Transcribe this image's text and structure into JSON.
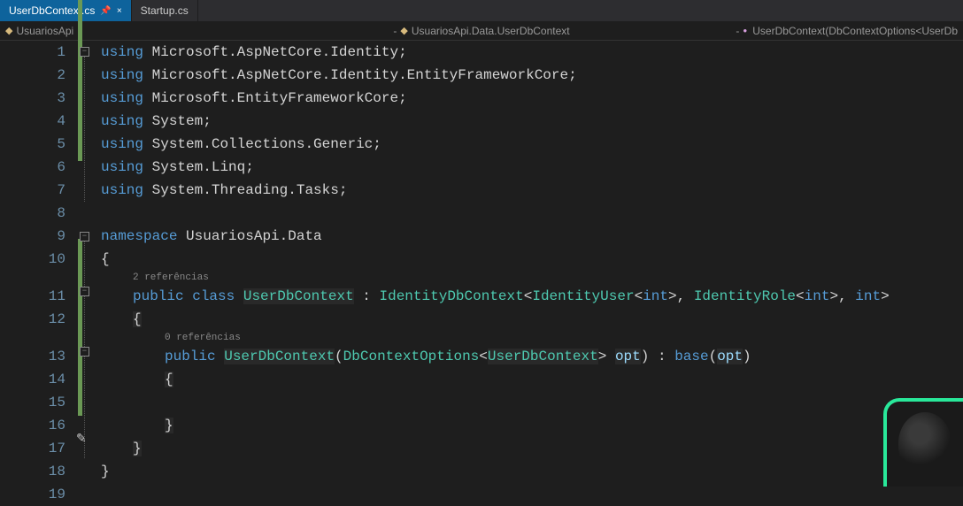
{
  "tabs": {
    "active": "UserDbContext.cs",
    "inactive": "Startup.cs"
  },
  "breadcrumbs": {
    "left": "UsuariosApi",
    "center": "UsuariosApi.Data.UserDbContext",
    "right": "UserDbContext(DbContextOptions<UserDb"
  },
  "line_numbers": [
    "1",
    "2",
    "3",
    "4",
    "5",
    "6",
    "7",
    "8",
    "9",
    "10",
    "11",
    "12",
    "13",
    "14",
    "15",
    "16",
    "17",
    "18",
    "19"
  ],
  "codelens": {
    "class": "2 referências",
    "ctor": "0 referências"
  },
  "tokens": {
    "using": "using",
    "namespace": "namespace",
    "public": "public",
    "class": "class",
    "base": "base",
    "int": "int",
    "ns1": "Microsoft.AspNetCore.Identity",
    "ns2": "Microsoft.AspNetCore.Identity.EntityFrameworkCore",
    "ns3": "Microsoft.EntityFrameworkCore",
    "ns4": "System",
    "ns5": "System.Collections.Generic",
    "ns6": "System.Linq",
    "ns7": "System.Threading.Tasks",
    "namespace_name": "UsuariosApi.Data",
    "class_name": "UserDbContext",
    "identity_db": "IdentityDbContext",
    "identity_user": "IdentityUser",
    "identity_role": "IdentityRole",
    "ctor_name": "UserDbContext",
    "options_type": "DbContextOptions",
    "param_name": "opt",
    "semicolon": ";",
    "obrace": "{",
    "cbrace": "}",
    "colon": ":",
    "lt": "<",
    "gt": ">",
    "comma": ",",
    "lparen": "(",
    "rparen": ")"
  }
}
